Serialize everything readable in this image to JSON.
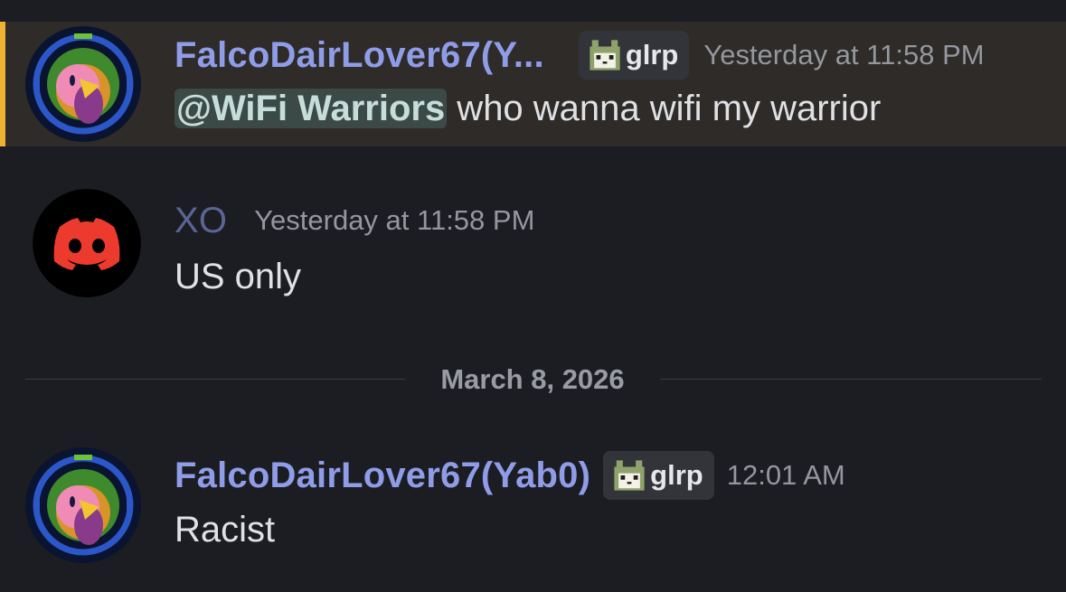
{
  "messages": [
    {
      "username": "FalcoDairLover67(Y...",
      "clan_tag": "glrp",
      "timestamp": "Yesterday at 11:58 PM",
      "mention": "@WiFi Warriors",
      "text": " who wanna wifi my warrior",
      "avatar_icon": "kirby-avatar-icon",
      "highlighted": true
    },
    {
      "username": "XO",
      "timestamp": "Yesterday at 11:58 PM",
      "text": "US only",
      "avatar_icon": "discord-logo-icon"
    },
    {
      "username": "FalcoDairLover67(Yab0)",
      "clan_tag": "glrp",
      "timestamp": "12:01 AM",
      "text": "Racist",
      "avatar_icon": "kirby-avatar-icon"
    }
  ],
  "date_divider": "March 8, 2026",
  "colors": {
    "background": "#1c1d22",
    "highlight_bg": "#2e2b28",
    "highlight_bar": "#f0b232",
    "username": "#8f9ce8",
    "mention_bg": "#3c4a47",
    "discord_red": "#ed3a2f"
  }
}
